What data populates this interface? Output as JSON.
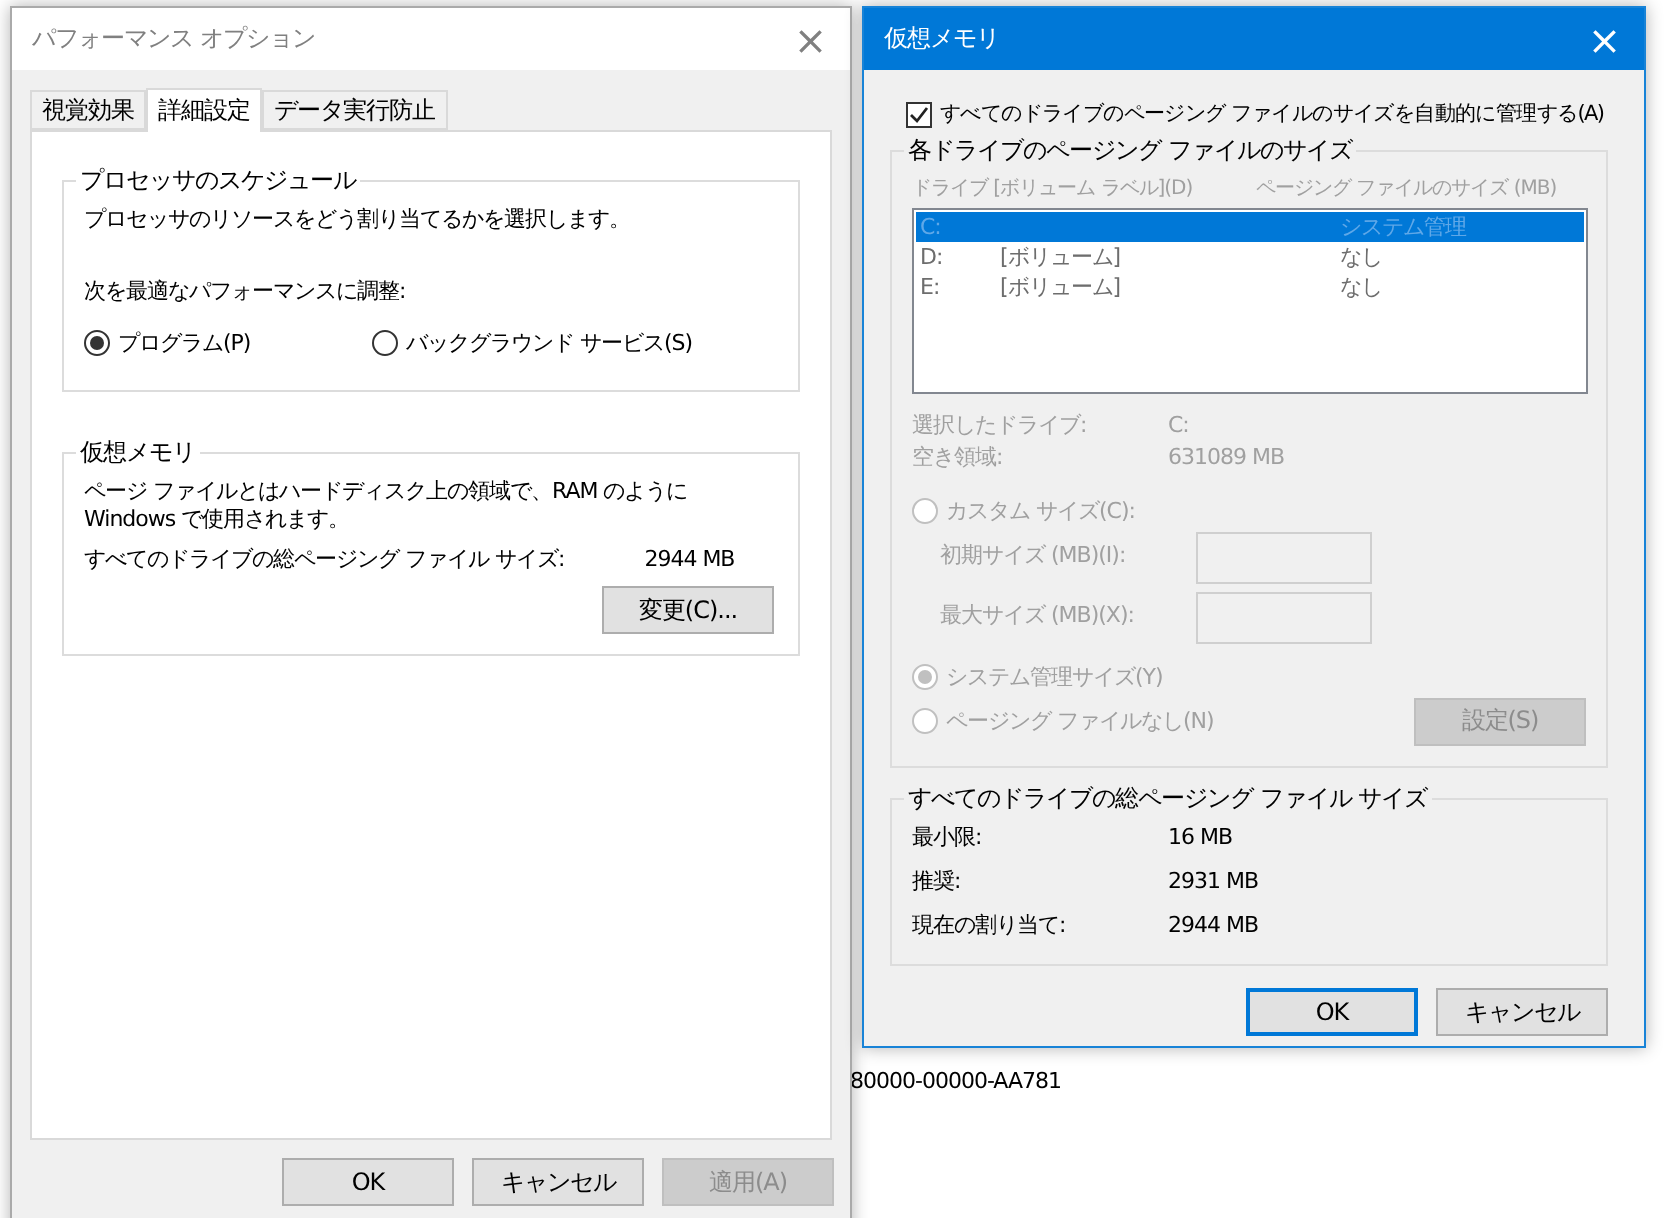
{
  "background": {
    "text": "80000-00000-AA781"
  },
  "performance_window": {
    "title": "パフォーマンス オプション",
    "close": "×",
    "tabs": [
      {
        "label": "視覚効果",
        "selected": false
      },
      {
        "label": "詳細設定",
        "selected": true
      },
      {
        "label": "データ実行防止",
        "selected": false
      }
    ],
    "processor_group": {
      "title": "プロセッサのスケジュール",
      "description": "プロセッサのリソースをどう割り当てるかを選択します。",
      "adjust_label": "次を最適なパフォーマンスに調整:",
      "options": [
        {
          "label": "プログラム(P)",
          "selected": true
        },
        {
          "label": "バックグラウンド サービス(S)",
          "selected": false
        }
      ]
    },
    "virtual_memory_group": {
      "title": "仮想メモリ",
      "description": "ページ ファイルとはハードディスク上の領域で、RAM のように Windows で使用されます。",
      "total_label": "すべてのドライブの総ページング ファイル サイズ:",
      "total_value": "2944 MB",
      "change_button": "変更(C)..."
    },
    "buttons": [
      {
        "label": "OK",
        "disabled": false
      },
      {
        "label": "キャンセル",
        "disabled": false
      },
      {
        "label": "適用(A)",
        "disabled": true
      }
    ]
  },
  "virtual_memory_window": {
    "title": "仮想メモリ",
    "close": "×",
    "auto_manage": {
      "label": "すべてのドライブのページング ファイルのサイズを自動的に管理する(A)",
      "checked": true
    },
    "drives_group": {
      "title": "各ドライブのページング ファイルのサイズ",
      "disabled": true,
      "columns": [
        "ドライブ  [ボリューム ラベル](D)",
        "ページング ファイルのサイズ (MB)"
      ],
      "drives": [
        {
          "drive": "C:",
          "size": "システム管理",
          "selected": true
        },
        {
          "drive": "D:",
          "label": "[ボリューム]",
          "size": "なし",
          "selected": false
        },
        {
          "drive": "E:",
          "label": "[ボリューム]",
          "size": "なし",
          "selected": false
        }
      ],
      "selected_drive_label": "選択したドライブ:",
      "selected_drive_value": "C:",
      "free_space_label": "空き領域:",
      "free_space_value": "631089 MB",
      "custom_option": {
        "label": "カスタム サイズ(C):",
        "selected": false
      },
      "initial_size_label": "初期サイズ (MB)(I):",
      "max_size_label": "最大サイズ (MB)(X):",
      "system_option": {
        "label": "システム管理サイズ(Y)",
        "selected": true
      },
      "none_option": {
        "label": "ページング ファイルなし(N)",
        "selected": false
      },
      "set_button": "設定(S)"
    },
    "totals_group": {
      "title": "すべてのドライブの総ページング ファイル サイズ",
      "rows": [
        {
          "label": "最小限:",
          "value": "16 MB"
        },
        {
          "label": "推奨:",
          "value": "2931 MB"
        },
        {
          "label": "現在の割り当て:",
          "value": "2944 MB"
        }
      ]
    },
    "buttons": [
      {
        "label": "OK",
        "default": true
      },
      {
        "label": "キャンセル",
        "default": false
      }
    ]
  }
}
